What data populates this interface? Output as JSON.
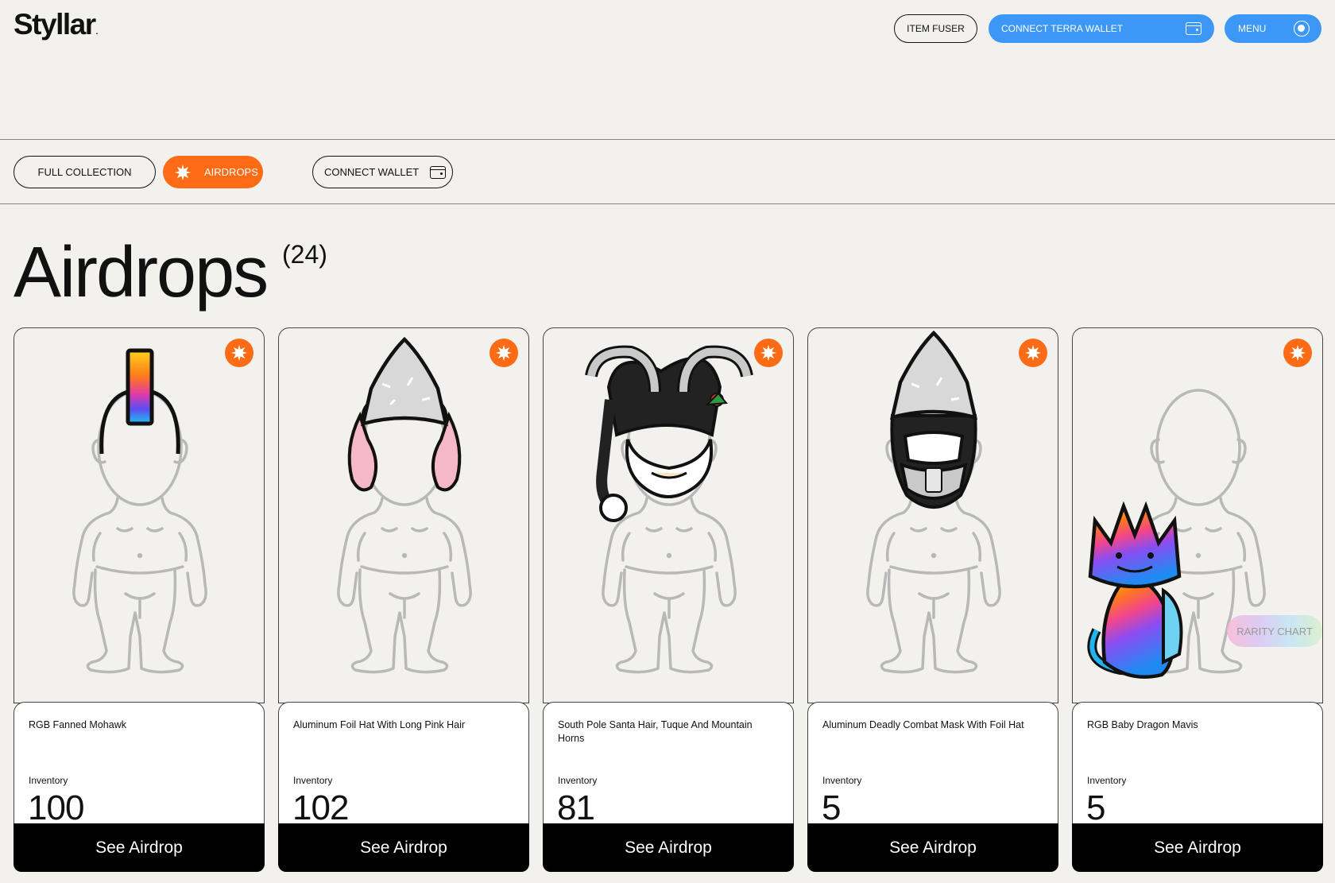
{
  "header": {
    "logo": "Styllar",
    "item_fuser": "ITEM FUSER",
    "connect_terra": "CONNECT TERRA WALLET",
    "menu": "MENU"
  },
  "filters": {
    "full_collection": "FULL COLLECTION",
    "airdrops": "AIRDROPS",
    "connect_wallet": "CONNECT WALLET"
  },
  "page": {
    "title": "Airdrops",
    "count": "(24)"
  },
  "cards": [
    {
      "name": "RGB Fanned Mohawk",
      "inventory_label": "Inventory",
      "inventory": "100",
      "cta": "See Airdrop"
    },
    {
      "name": "Aluminum Foil Hat With Long Pink Hair",
      "inventory_label": "Inventory",
      "inventory": "102",
      "cta": "See Airdrop"
    },
    {
      "name": "South Pole Santa Hair, Tuque And Mountain Horns",
      "inventory_label": "Inventory",
      "inventory": "81",
      "cta": "See Airdrop"
    },
    {
      "name": "Aluminum Deadly Combat Mask With Foil Hat",
      "inventory_label": "Inventory",
      "inventory": "5",
      "cta": "See Airdrop"
    },
    {
      "name": "RGB Baby Dragon Mavis",
      "inventory_label": "Inventory",
      "inventory": "5",
      "cta": "See Airdrop"
    }
  ],
  "rarity_chart": "RARITY CHART",
  "colors": {
    "background": "#f2f1ee",
    "accent_blue": "#3d97f7",
    "accent_orange": "#ff6a14",
    "button_black": "#000000"
  },
  "icons": [
    "wallet-icon",
    "radio-icon",
    "burst-icon"
  ]
}
